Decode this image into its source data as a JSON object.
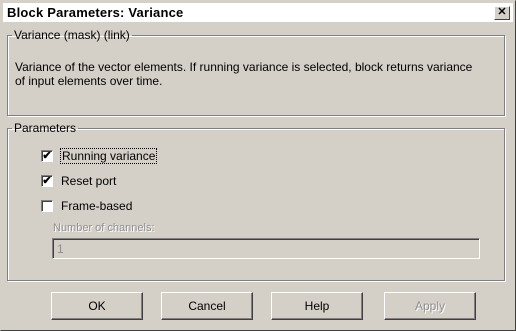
{
  "window": {
    "title": "Block Parameters: Variance",
    "close_glyph": "✕"
  },
  "mask_group": {
    "legend": "Variance (mask) (link)",
    "description": "Variance of the vector elements. If running variance is selected, block returns variance of input elements over time."
  },
  "params_group": {
    "legend": "Parameters",
    "checkboxes": [
      {
        "label": "Running variance",
        "checked": true,
        "mark": "✔"
      },
      {
        "label": "Reset port",
        "checked": true,
        "mark": "✔"
      },
      {
        "label": "Frame-based",
        "checked": false,
        "mark": ""
      }
    ],
    "channels_label": "Number of channels:",
    "channels_value": "1"
  },
  "buttons": {
    "ok": "OK",
    "cancel": "Cancel",
    "help": "Help",
    "apply": "Apply"
  }
}
